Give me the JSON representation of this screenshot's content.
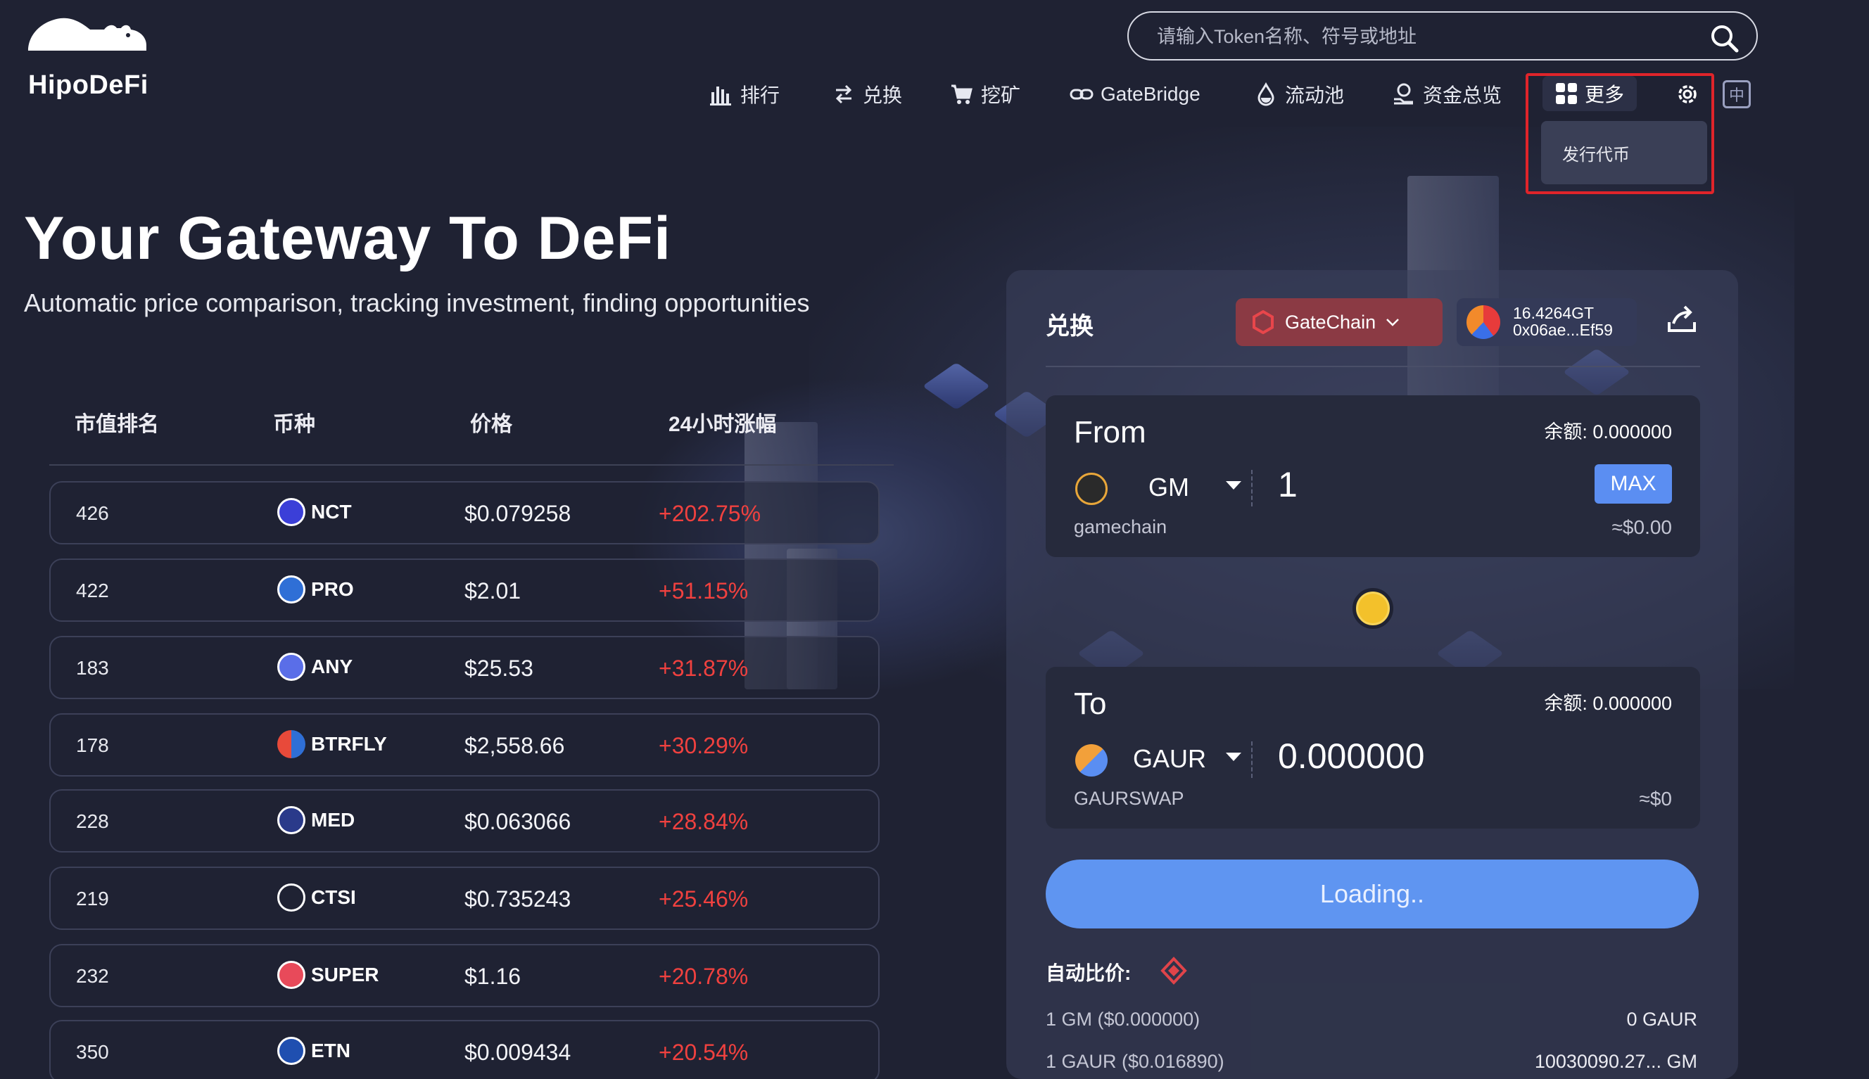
{
  "header": {
    "brand": "HipoDeFi",
    "search_placeholder": "请输入Token名称、符号或地址",
    "nav": [
      {
        "label": "排行",
        "icon": "bar-chart-icon"
      },
      {
        "label": "兑换",
        "icon": "swap-arrows-icon"
      },
      {
        "label": "挖矿",
        "icon": "cart-icon"
      },
      {
        "label": "GateBridge",
        "icon": "link-icon"
      },
      {
        "label": "流动池",
        "icon": "drop-icon"
      },
      {
        "label": "资金总览",
        "icon": "wallet-hand-icon"
      }
    ],
    "more_label": "更多",
    "more_dropdown": [
      "发行代币"
    ],
    "lang_label": "中"
  },
  "hero": {
    "title": "Your Gateway To DeFi",
    "subtitle": "Automatic price comparison, tracking investment, finding opportunities"
  },
  "table": {
    "headers": [
      "市值排名",
      "币种",
      "价格",
      "24小时涨幅"
    ],
    "rows": [
      {
        "rank": "426",
        "symbol": "NCT",
        "price": "$0.079258",
        "change": "+202.75%",
        "color": "#3b3fd8"
      },
      {
        "rank": "422",
        "symbol": "PRO",
        "price": "$2.01",
        "change": "+51.15%",
        "color": "#2f6fd6"
      },
      {
        "rank": "183",
        "symbol": "ANY",
        "price": "$25.53",
        "change": "+31.87%",
        "color": "#5a6ee8"
      },
      {
        "rank": "178",
        "symbol": "BTRFLY",
        "price": "$2,558.66",
        "change": "+30.29%",
        "color": "#e84a3a"
      },
      {
        "rank": "228",
        "symbol": "MED",
        "price": "$0.063066",
        "change": "+28.84%",
        "color": "#2a3a8a"
      },
      {
        "rank": "219",
        "symbol": "CTSI",
        "price": "$0.735243",
        "change": "+25.46%",
        "color": "#1f2233"
      },
      {
        "rank": "232",
        "symbol": "SUPER",
        "price": "$1.16",
        "change": "+20.78%",
        "color": "#e84a5a"
      },
      {
        "rank": "350",
        "symbol": "ETN",
        "price": "$0.009434",
        "change": "+20.54%",
        "color": "#1f4fb0"
      }
    ]
  },
  "swap": {
    "title": "兑换",
    "chain": "GateChain",
    "wallet_balance": "16.4264GT",
    "wallet_address": "0x06ae...Ef59",
    "from": {
      "label": "From",
      "balance": "余额: 0.000000",
      "token": "GM",
      "token_name": "gamechain",
      "amount": "1",
      "usd": "≈$0.00",
      "max_label": "MAX"
    },
    "to": {
      "label": "To",
      "balance": "余额: 0.000000",
      "token": "GAUR",
      "token_name": "GAURSWAP",
      "amount": "0.000000",
      "usd": "≈$0"
    },
    "button": "Loading..",
    "auto_compare": "自动比价:",
    "rates": [
      {
        "left": "1 GM ($0.000000)",
        "right": "0 GAUR"
      },
      {
        "left": "1 GAUR ($0.016890)",
        "right": "10030090.27... GM"
      }
    ]
  },
  "colors": {
    "background": "#1f2233",
    "positive_change": "#f0413f",
    "accent_blue": "#5f95f1",
    "highlight_border": "#e0242a"
  }
}
